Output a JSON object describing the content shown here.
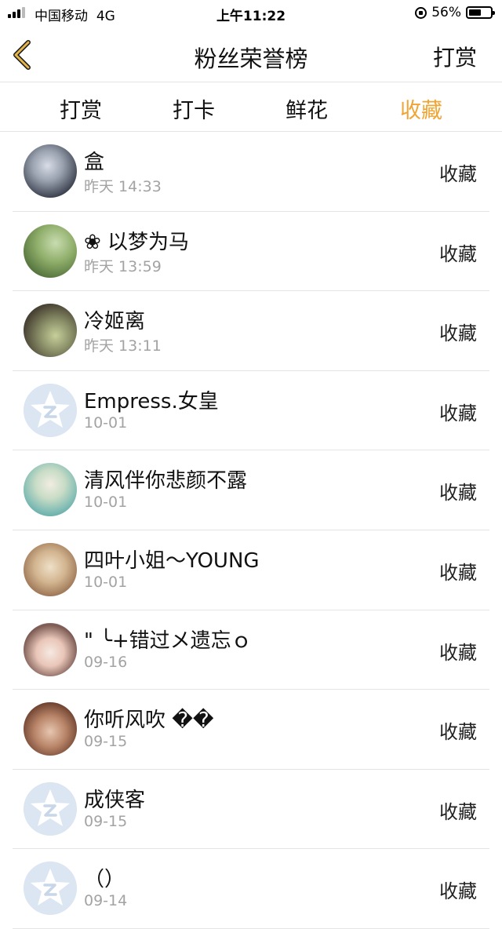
{
  "status_bar": {
    "carrier": "中国移动",
    "network": "4G",
    "time": "上午11:22",
    "battery_percent": "56%",
    "battery_level": 0.56
  },
  "nav": {
    "title": "粉丝荣誉榜",
    "right_action": "打赏",
    "back_icon": "chevron-left-icon",
    "accent_color": "#efa533"
  },
  "tabs": [
    {
      "label": "打赏",
      "active": false
    },
    {
      "label": "打卡",
      "active": false
    },
    {
      "label": "鲜花",
      "active": false
    },
    {
      "label": "收藏",
      "active": true
    }
  ],
  "list": [
    {
      "name": "盒",
      "date": "昨天 14:33",
      "action": "收藏",
      "avatar": "photo"
    },
    {
      "name": "❀ 以梦为马",
      "date": "昨天 13:59",
      "action": "收藏",
      "avatar": "photo"
    },
    {
      "name": "冷姬离",
      "date": "昨天 13:11",
      "action": "收藏",
      "avatar": "photo"
    },
    {
      "name": "Empress.女皇",
      "date": "10-01",
      "action": "收藏",
      "avatar": "default"
    },
    {
      "name": "清风伴你悲颜不露",
      "date": "10-01",
      "action": "收藏",
      "avatar": "photo"
    },
    {
      "name": "四叶小姐～YOUNG",
      "date": "10-01",
      "action": "收藏",
      "avatar": "photo"
    },
    {
      "name": "\"  ╰+错过メ遗忘ｏ",
      "date": "09-16",
      "action": "收藏",
      "avatar": "photo"
    },
    {
      "name": "你听风吹 ��",
      "date": "09-15",
      "action": "收藏",
      "avatar": "photo"
    },
    {
      "name": "成侠客",
      "date": "09-15",
      "action": "收藏",
      "avatar": "default"
    },
    {
      "name": "（）",
      "date": "09-14",
      "action": "收藏",
      "avatar": "default"
    }
  ]
}
